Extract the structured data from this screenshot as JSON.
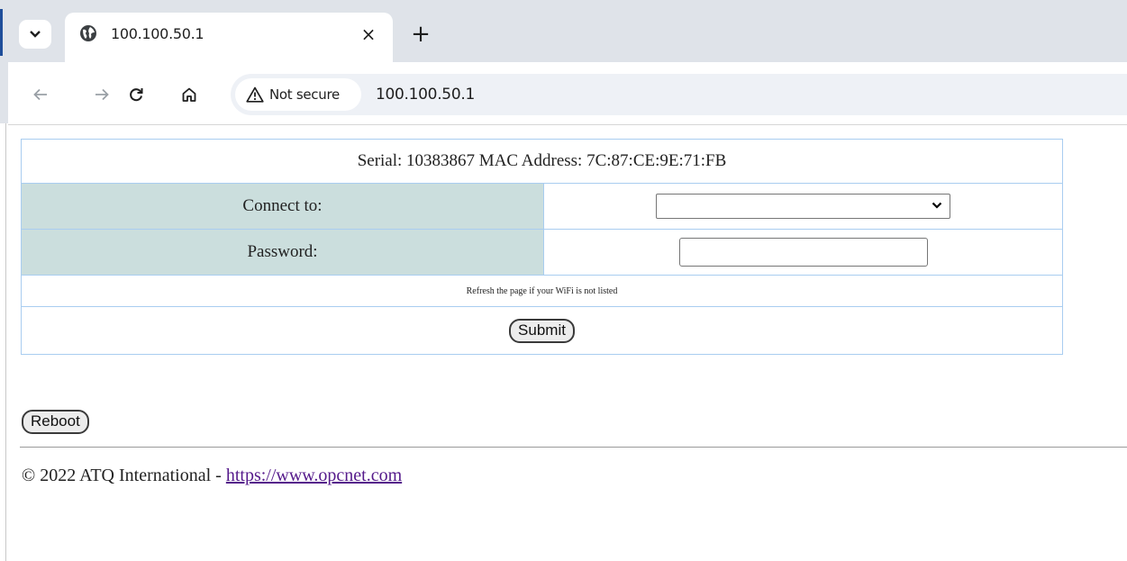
{
  "browser": {
    "tab": {
      "title": "100.100.50.1",
      "close_glyph": "×",
      "favicon": "globe-icon"
    },
    "new_tab_glyph": "+",
    "toolbar": {
      "security_label": "Not secure",
      "url": "100.100.50.1"
    }
  },
  "page": {
    "serial_line": "Serial: 10383867 MAC Address: 7C:87:CE:9E:71:FB",
    "connect_label": "Connect to:",
    "connect_value": "",
    "password_label": "Password:",
    "password_value": "",
    "hint": "Refresh the page if your WiFi is not listed",
    "submit_label": "Submit",
    "reboot_label": "Reboot",
    "footer_text": "© 2022 ATQ International - ",
    "footer_link": "https://www.opcnet.com"
  },
  "colors": {
    "label_cell_bg": "#cbdedd",
    "table_border": "#a9cdf0",
    "link": "#551a8b"
  }
}
